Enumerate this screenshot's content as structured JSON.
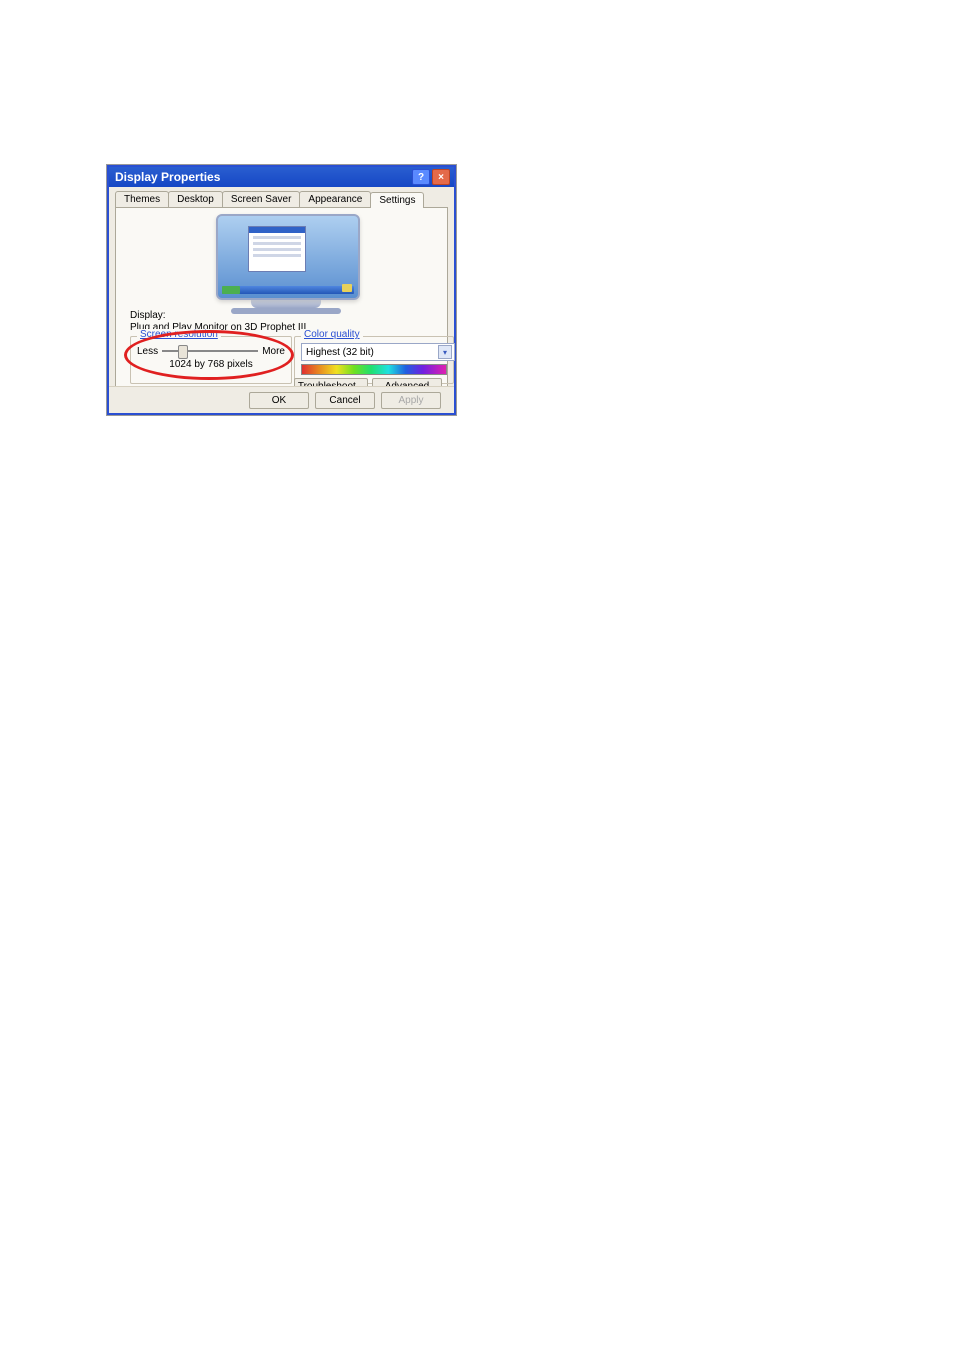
{
  "window": {
    "title": "Display Properties",
    "help_icon": "?",
    "close_icon": "×"
  },
  "tabs": {
    "items": [
      {
        "label": "Themes"
      },
      {
        "label": "Desktop"
      },
      {
        "label": "Screen Saver"
      },
      {
        "label": "Appearance"
      },
      {
        "label": "Settings"
      }
    ],
    "active_index": 4
  },
  "display": {
    "label": "Display:",
    "value_prefix": "Plug and Play ",
    "value_underlined": "Monitor",
    "value_suffix": " on 3D Prophet III"
  },
  "screen_resolution": {
    "legend": "Screen resolution",
    "less": "Less",
    "more": "More",
    "value": "1024 by 768 pixels"
  },
  "color_quality": {
    "legend": "Color quality",
    "selected": "Highest (32 bit)"
  },
  "buttons": {
    "troubleshoot": "Troubleshoot...",
    "advanced": "Advanced",
    "ok": "OK",
    "cancel": "Cancel",
    "apply": "Apply"
  }
}
